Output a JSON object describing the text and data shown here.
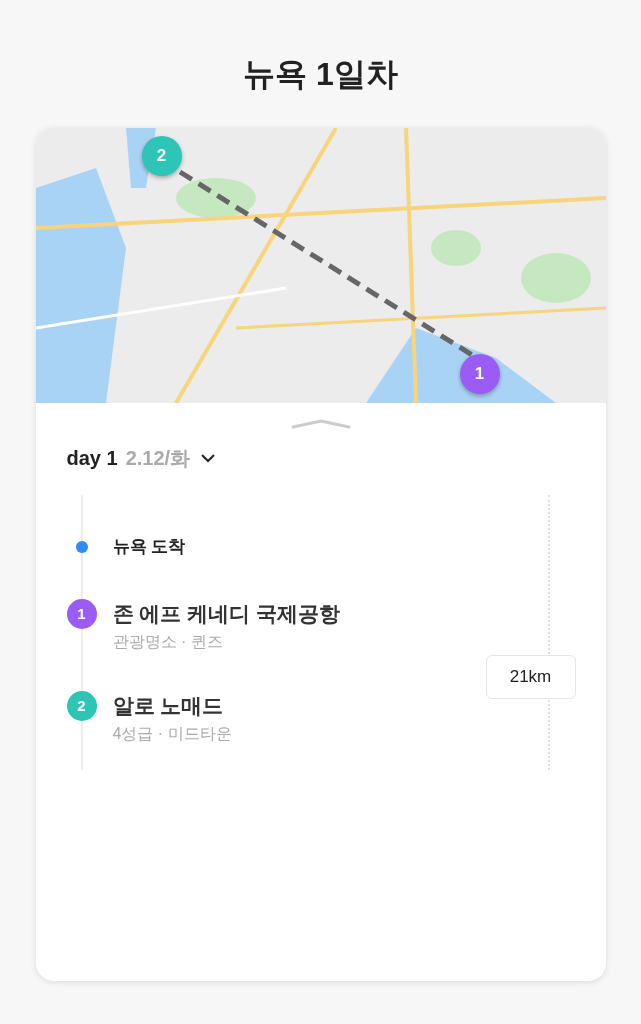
{
  "title": "뉴욕 1일차",
  "map": {
    "markers": [
      {
        "label": "2",
        "color": "#2ec4b6"
      },
      {
        "label": "1",
        "color": "#9b5cf6"
      }
    ]
  },
  "day": {
    "label": "day 1",
    "date": "2.12/화"
  },
  "timeline": [
    {
      "kind": "event",
      "title": "뉴욕 도착",
      "color": "#2f8cf0"
    },
    {
      "kind": "place",
      "badge": "1",
      "color": "#9b5cf6",
      "title": "존 에프 케네디 국제공항",
      "subtitle": "관광명소 · 퀸즈"
    },
    {
      "kind": "place",
      "badge": "2",
      "color": "#2ec4b6",
      "title": "알로 노매드",
      "subtitle": "4성급 · 미드타운"
    }
  ],
  "distance": "21km"
}
